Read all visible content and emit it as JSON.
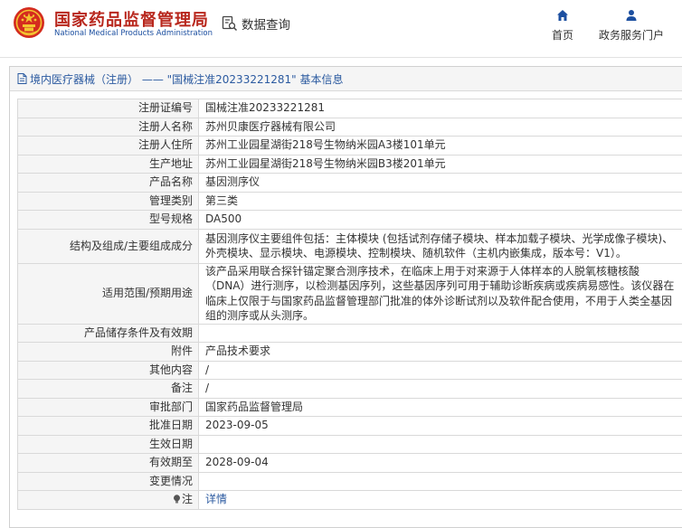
{
  "header": {
    "org_name_cn": "国家药品监督管理局",
    "org_name_en": "National Medical Products Administration",
    "search_label": "数据查询",
    "nav": {
      "home": "首页",
      "service": "政务服务门户"
    }
  },
  "panel": {
    "title": "境内医疗器械（注册） —— \"国械注准20233221281\" 基本信息"
  },
  "fields": [
    {
      "label": "注册证编号",
      "value": "国械注准20233221281"
    },
    {
      "label": "注册人名称",
      "value": "苏州贝康医疗器械有限公司"
    },
    {
      "label": "注册人住所",
      "value": "苏州工业园星湖街218号生物纳米园A3楼101单元"
    },
    {
      "label": "生产地址",
      "value": "苏州工业园星湖街218号生物纳米园B3楼201单元"
    },
    {
      "label": "产品名称",
      "value": "基因测序仪"
    },
    {
      "label": "管理类别",
      "value": "第三类"
    },
    {
      "label": "型号规格",
      "value": "DA500"
    },
    {
      "label": "结构及组成/主要组成成分",
      "value": "基因测序仪主要组件包括：主体模块 (包括试剂存储子模块、样本加载子模块、光学成像子模块)、外壳模块、显示模块、电源模块、控制模块、随机软件（主机内嵌集成，版本号：V1）。"
    },
    {
      "label": "适用范围/预期用途",
      "value": "该产品采用联合探针锚定聚合测序技术，在临床上用于对来源于人体样本的人脱氧核糖核酸（DNA）进行测序，以检测基因序列，这些基因序列可用于辅助诊断疾病或疾病易感性。该仪器在临床上仅限于与国家药品监督管理部门批准的体外诊断试剂以及软件配合使用，不用于人类全基因组的测序或从头测序。"
    },
    {
      "label": "产品储存条件及有效期",
      "value": ""
    },
    {
      "label": "附件",
      "value": "产品技术要求"
    },
    {
      "label": "其他内容",
      "value": "/"
    },
    {
      "label": "备注",
      "value": "/"
    },
    {
      "label": "审批部门",
      "value": "国家药品监督管理局"
    },
    {
      "label": "批准日期",
      "value": "2023-09-05"
    },
    {
      "label": "生效日期",
      "value": ""
    },
    {
      "label": "有效期至",
      "value": "2028-09-04"
    },
    {
      "label": "变更情况",
      "value": ""
    },
    {
      "label": "注",
      "value": "详情"
    }
  ],
  "colors": {
    "brand_red": "#b8271d",
    "brand_blue": "#1c4fa0",
    "link_blue": "#2b5aa0",
    "label_bg": "#f5f5f5",
    "border": "#d9d9d9"
  },
  "icons": {
    "emblem": "national-emblem-icon",
    "search": "search-document-icon",
    "home": "home-icon",
    "service": "user-icon",
    "title": "document-icon",
    "note": "lightbulb-icon"
  }
}
